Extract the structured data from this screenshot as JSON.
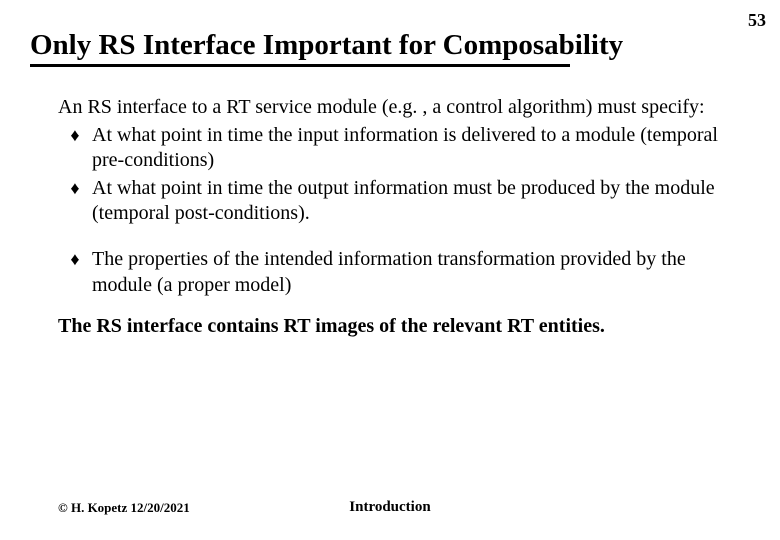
{
  "page_number": "53",
  "title": "Only RS Interface Important for Composability",
  "intro": "An RS interface  to a RT service module (e.g. , a control algorithm) must specify:",
  "bullets": [
    "At what point in time the  input information is delivered to a module (temporal pre-conditions)",
    "At what point in time the output information must be produced by the module (temporal post-conditions).",
    "The properties of the intended  information transformation  provided by the module (a proper model)"
  ],
  "closing": "The RS interface contains RT images of the relevant RT entities.",
  "footer_left": "© H. Kopetz  12/20/2021",
  "footer_center": "Introduction"
}
